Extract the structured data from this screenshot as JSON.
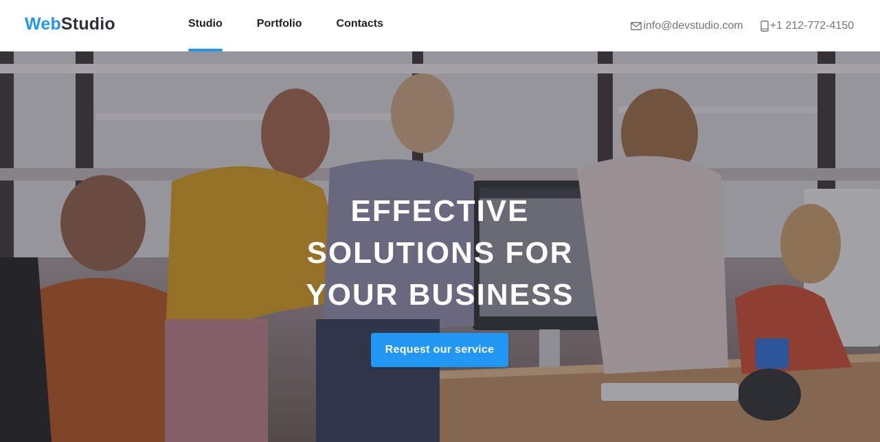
{
  "logo": {
    "accent": "Web",
    "rest": "Studio"
  },
  "nav": [
    {
      "label": "Studio",
      "active": true
    },
    {
      "label": "Portfolio",
      "active": false
    },
    {
      "label": "Contacts",
      "active": false
    }
  ],
  "contacts": {
    "email": "info@devstudio.com",
    "phone": "+1 212-772-4150",
    "email_icon": "envelope-icon",
    "phone_icon": "smartphone-icon"
  },
  "hero": {
    "title_lines": [
      "EFFECTIVE",
      "SOLUTIONS FOR",
      "YOUR BUSINESS"
    ],
    "cta_label": "Request our service",
    "image": "office-team-photo"
  },
  "colors": {
    "accent": "#2196f3",
    "text_dark": "#212121",
    "text_muted": "#757575",
    "logo_dark": "#2f303a"
  }
}
